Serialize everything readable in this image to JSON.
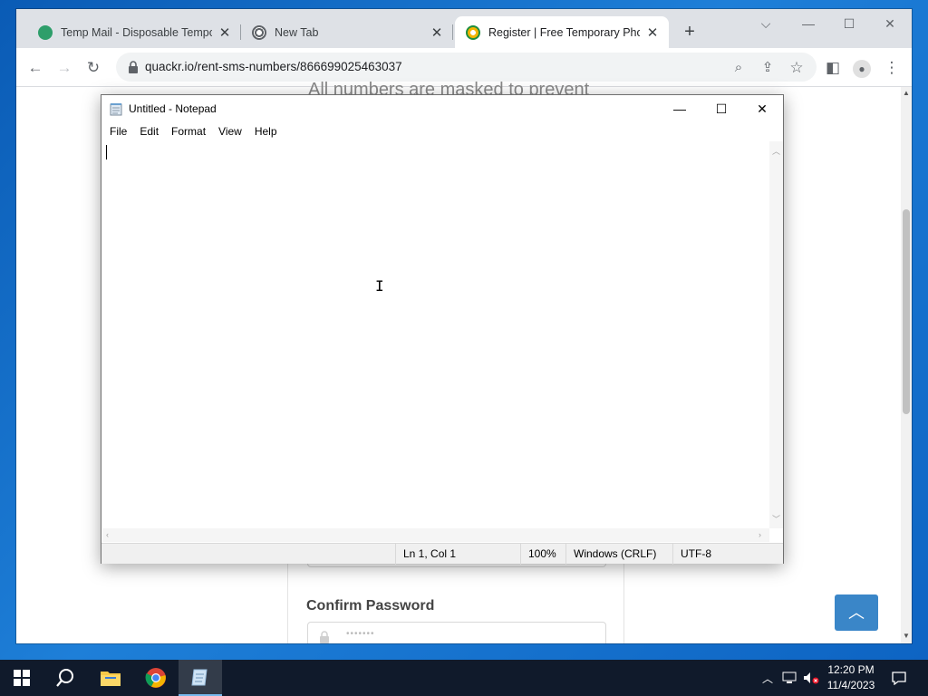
{
  "browser": {
    "tabs": [
      {
        "title": "Temp Mail - Disposable Temporary",
        "favicon_color": "#2e9e6a"
      },
      {
        "title": "New Tab",
        "favicon_color": "#9aa0a6"
      },
      {
        "title": "Register | Free Temporary Phone",
        "favicon_color": "#f4b400"
      }
    ],
    "active_tab": 2,
    "url": "quackr.io/rent-sms-numbers/866699025463037",
    "toolbar_icons": [
      "back-icon",
      "forward-icon",
      "reload-icon",
      "zoom-icon",
      "share-icon",
      "star-icon",
      "side-panel-icon",
      "profile-icon",
      "menu-icon"
    ],
    "window_controls": [
      "chevron-down-icon",
      "minimize-icon",
      "maximize-icon",
      "close-icon"
    ]
  },
  "page": {
    "partial_heading": "All numbers are masked to prevent",
    "confirm_label": "Confirm Password",
    "password_dots": "•••••••",
    "scroll_top_icon": "chevron-up-icon"
  },
  "notepad": {
    "title": "Untitled - Notepad",
    "menu": [
      "File",
      "Edit",
      "Format",
      "View",
      "Help"
    ],
    "status": {
      "position": "Ln 1, Col 1",
      "zoom": "100%",
      "line_ending": "Windows (CRLF)",
      "encoding": "UTF-8"
    }
  },
  "taskbar": {
    "apps": [
      "start-icon",
      "search-icon",
      "file-explorer-icon",
      "chrome-icon",
      "notepad-icon"
    ],
    "active_app": "notepad-icon",
    "time": "12:20 PM",
    "date": "11/4/2023"
  },
  "colors": {
    "desktop": "#0a5bb5",
    "taskbar": "#101a2b",
    "accent": "#3a86c8"
  }
}
